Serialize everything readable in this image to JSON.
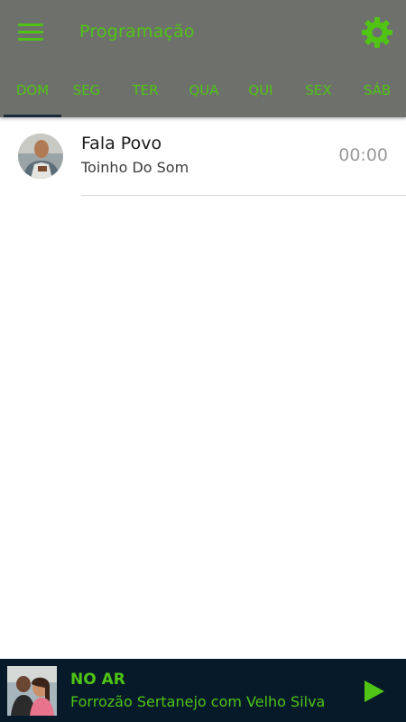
{
  "header": {
    "title": "Programação",
    "menu_icon": "hamburger-menu-icon",
    "settings_icon": "gear-icon",
    "accent_color": "#4fc414",
    "bar_color": "#6e716b"
  },
  "tabs": [
    {
      "label": "DOM",
      "active": true
    },
    {
      "label": "SEG",
      "active": false
    },
    {
      "label": "TER",
      "active": false
    },
    {
      "label": "QUA",
      "active": false
    },
    {
      "label": "QUI",
      "active": false
    },
    {
      "label": "SEX",
      "active": false
    },
    {
      "label": "SÁB",
      "active": false
    }
  ],
  "schedule": [
    {
      "name": "Fala Povo",
      "host": "Toinho Do Som",
      "time": "00:00"
    }
  ],
  "now_playing": {
    "label": "NO AR",
    "title": "Forrozão Sertanejo com Velho Silva",
    "play_icon": "play-icon",
    "background_color": "#061a2a"
  }
}
